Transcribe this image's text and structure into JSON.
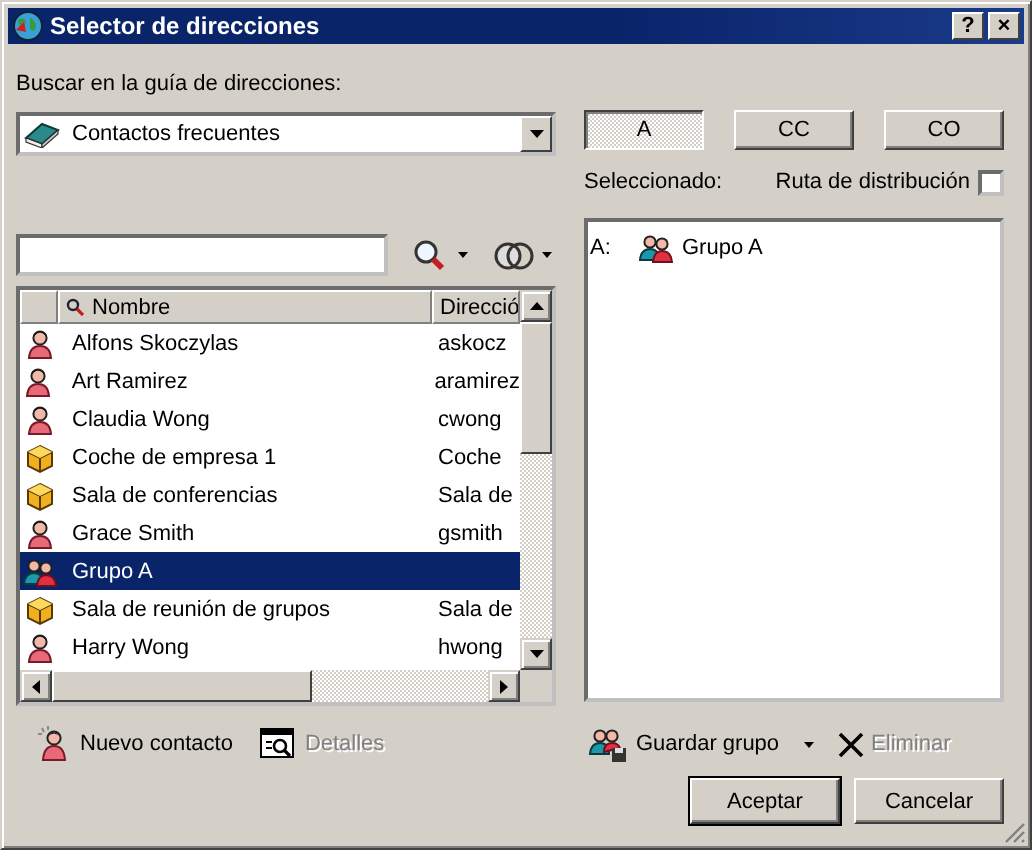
{
  "window": {
    "title": "Selector de direcciones",
    "title_buttons": [
      "?",
      "×"
    ]
  },
  "address_book": {
    "label": "Buscar en la guía de direcciones:",
    "value": "Contactos frecuentes"
  },
  "recipient_fields": [
    {
      "label": "A",
      "selected": true
    },
    {
      "label": "CC",
      "selected": false
    },
    {
      "label": "CO",
      "selected": false
    }
  ],
  "selected_label": "Seleccionado:",
  "distribution_route": {
    "label": "Ruta de distribución",
    "checked": false
  },
  "contacts": {
    "columns": [
      "Nombre",
      "Direcció"
    ],
    "rows": [
      {
        "kind": "contact",
        "name": "Alfons Skoczylas",
        "address": "askocz",
        "selected": false
      },
      {
        "kind": "contact",
        "name": "Art Ramirez",
        "address": "aramirez",
        "selected": false
      },
      {
        "kind": "contact",
        "name": "Claudia Wong",
        "address": "cwong",
        "selected": false
      },
      {
        "kind": "resource",
        "name": "Coche de empresa 1",
        "address": "Coche",
        "selected": false
      },
      {
        "kind": "resource",
        "name": "Sala de conferencias",
        "address": "Sala de",
        "selected": false
      },
      {
        "kind": "contact",
        "name": "Grace Smith",
        "address": "gsmith",
        "selected": false
      },
      {
        "kind": "group",
        "name": "Grupo A",
        "selected": true
      },
      {
        "kind": "resource",
        "name": "Sala de reunión de grupos",
        "address": "Sala de",
        "selected": false
      },
      {
        "kind": "contact",
        "name": "Harry Wong",
        "address": "hwong",
        "selected": false
      }
    ]
  },
  "recipients": [
    {
      "field": "A:",
      "kind": "group",
      "name": "Grupo A"
    }
  ],
  "left_actions": [
    {
      "kind": "new-contact",
      "label": "Nuevo contacto",
      "disabled": false
    },
    {
      "kind": "details",
      "label": "Detalles",
      "disabled": true
    }
  ],
  "right_actions": [
    {
      "kind": "save-group",
      "label": "Guardar grupo",
      "dropdown": true,
      "disabled": false
    },
    {
      "kind": "delete",
      "label": "Eliminar",
      "dropdown": false,
      "disabled": true
    }
  ],
  "buttons": [
    {
      "label": "Aceptar",
      "default": true
    },
    {
      "label": "Cancelar",
      "default": false
    }
  ]
}
